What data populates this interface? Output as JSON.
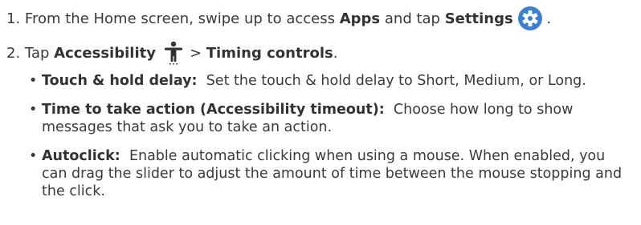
{
  "steps": [
    {
      "number": "1.",
      "text_before": "From the Home screen, swipe up to access",
      "bold_1": "Apps",
      "text_middle": "and tap",
      "bold_2": "Settings",
      "icon": "settings-gear-icon",
      "text_after": "."
    },
    {
      "number": "2.",
      "text_before": "Tap",
      "bold_1": "Accessibility",
      "icon": "accessibility-person-icon",
      "separator": ">",
      "bold_2": "Timing controls",
      "text_after": "."
    }
  ],
  "bullets": [
    {
      "term": "Touch & hold delay:",
      "description": "Set the touch & hold delay to Short, Medium, or Long."
    },
    {
      "term": "Time to take action (Accessibility timeout):",
      "description": "Choose how long to show messages that ask you to take an action."
    },
    {
      "term": "Autoclick:",
      "description": "Enable automatic clicking when using a mouse. When enabled, you can drag the slider to adjust the amount of time between the mouse stopping and the click."
    }
  ],
  "colors": {
    "text": "#3a3a3a",
    "icon_blue": "#3e7fd6"
  }
}
